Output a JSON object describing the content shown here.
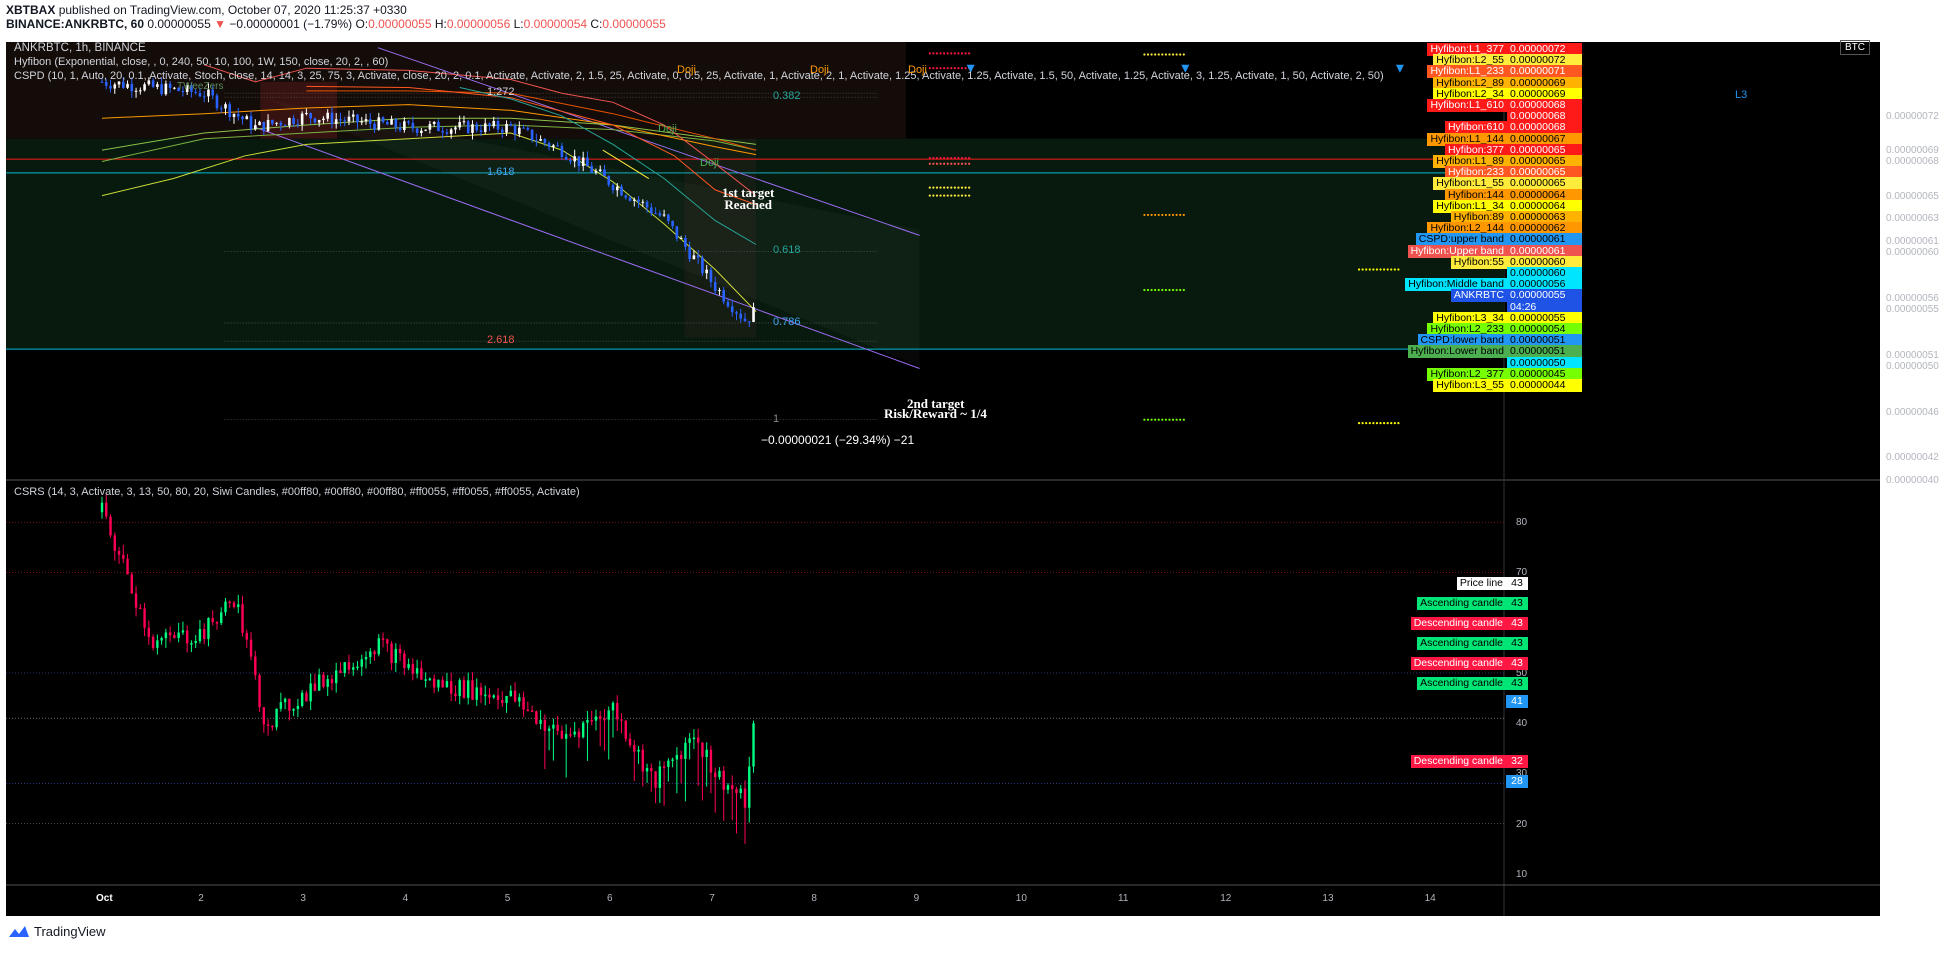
{
  "header": {
    "publisher": "XBTBAX",
    "published_on": "published on TradingView.com, October 07, 2020 11:25:37 +0330",
    "symbol": "BINANCE:ANKRBTC, 60",
    "price": "0.00000055",
    "change": "−0.00000001 (−1.79%)",
    "o_label": "O:",
    "o": "0.00000055",
    "h_label": "H:",
    "h": "0.00000056",
    "l_label": "L:",
    "l": "0.00000054",
    "c_label": "C:",
    "c": "0.00000055"
  },
  "main_pane": {
    "title": "ANKRBTC, 1h, BINANCE",
    "indicator_1": "Hyfibon (Exponential, close, , 0, 240, 50, 10, 100, 1W, 150, close, 20, 2, , 60)",
    "indicator_2": "CSPD (10, 1, Auto, 20, 0.1, Activate, Stoch, close, 14, 14, 3, 25, 75, 3, Activate, close, 20, 2, 0.1, Activate, Activate, 2, 1.5, 25, Activate, 0, 0.5, 25, Activate, 1, Activate, 2, 1, Activate, 1.25, Activate, 1.25, Activate, 1.5, 50, Activate, 1.25, Activate, 3, 1.25, Activate, 1, 50, Activate, 2, 50)",
    "currency": "BTC",
    "watermark": "TWeeZers",
    "annotations": {
      "target1": "1st target\nReached",
      "target2": "2nd target",
      "risk_reward": "Risk/Reward ~ 1/4",
      "measure": "−0.00000021 (−29.34%) −21",
      "doji": "Doji",
      "l3": "L3"
    },
    "fib_levels": [
      {
        "label": "1:272",
        "value": 7.4e-07
      },
      {
        "label": "1.618",
        "value": 6.7e-07
      },
      {
        "label": "2.618",
        "value": 5.22e-07
      },
      {
        "label": "0.382",
        "value": 7.365e-07
      },
      {
        "label": "0.618",
        "value": 6.01e-07
      },
      {
        "label": "0.786",
        "value": 5.38e-07
      },
      {
        "label": "1",
        "value": 4.53e-07
      }
    ],
    "price_axis": {
      "min": 4e-07,
      "max": 7.85e-07,
      "ticks": [
        "0.00000072",
        "0.00000069",
        "0.00000068",
        "0.00000065",
        "0.00000063",
        "0.00000061",
        "0.00000060",
        "0.00000056",
        "0.00000055",
        "0.00000051",
        "0.00000050",
        "0.00000046",
        "0.00000042",
        "0.00000040"
      ]
    },
    "price_labels": [
      {
        "name": "Hyfibon:L1_377",
        "value": "0.00000072",
        "color": "#ff1a1a"
      },
      {
        "name": "Hyfibon:L2_55",
        "value": "0.00000072",
        "color": "#ffeb3b"
      },
      {
        "name": "Hyfibon:L1_233",
        "value": "0.00000071",
        "color": "#ff5722"
      },
      {
        "name": "Hyfibon:L2_89",
        "value": "0.00000069",
        "color": "#ffb300"
      },
      {
        "name": "Hyfibon:L2_34",
        "value": "0.00000069",
        "color": "#ffff00"
      },
      {
        "name": "Hyfibon:L1_610",
        "value": "0.00000068",
        "color": "#ff1a1a"
      },
      {
        "name": "",
        "value": "0.00000068",
        "color": "#ff1a1a"
      },
      {
        "name": "Hyfibon:610",
        "value": "0.00000068",
        "color": "#ff1a1a"
      },
      {
        "name": "Hyfibon:L1_144",
        "value": "0.00000067",
        "color": "#ff9800"
      },
      {
        "name": "Hyfibon:377",
        "value": "0.00000065",
        "color": "#ff1a1a"
      },
      {
        "name": "Hyfibon:L1_89",
        "value": "0.00000065",
        "color": "#ffb300"
      },
      {
        "name": "Hyfibon:233",
        "value": "0.00000065",
        "color": "#ff5722"
      },
      {
        "name": "Hyfibon:L1_55",
        "value": "0.00000065",
        "color": "#ffeb3b"
      },
      {
        "name": "Hyfibon:144",
        "value": "0.00000064",
        "color": "#ff9800"
      },
      {
        "name": "Hyfibon:L1_34",
        "value": "0.00000064",
        "color": "#ffff00"
      },
      {
        "name": "Hyfibon:89",
        "value": "0.00000063",
        "color": "#ffb300"
      },
      {
        "name": "Hyfibon:L2_144",
        "value": "0.00000062",
        "color": "#ff9800"
      },
      {
        "name": "CSPD:upper band",
        "value": "0.00000061",
        "color": "#2196f3"
      },
      {
        "name": "Hyfibon:Upper band",
        "value": "0.00000061",
        "color": "#ef5350"
      },
      {
        "name": "Hyfibon:55",
        "value": "0.00000060",
        "color": "#ffeb3b"
      },
      {
        "name": "",
        "value": "0.00000060",
        "color": "#00e5ff"
      },
      {
        "name": "Hyfibon:Middle band",
        "value": "0.00000056",
        "color": "#00e5ff"
      },
      {
        "name": "ANKRBTC",
        "value": "0.00000055",
        "color": "#1e53e5"
      },
      {
        "name": "",
        "value": "04:26",
        "color": "#1e53e5"
      },
      {
        "name": "Hyfibon:L3_34",
        "value": "0.00000055",
        "color": "#ffff00"
      },
      {
        "name": "Hyfibon:L2_233",
        "value": "0.00000054",
        "color": "#76ff03"
      },
      {
        "name": "CSPD:lower band",
        "value": "0.00000051",
        "color": "#2196f3"
      },
      {
        "name": "Hyfibon:Lower band",
        "value": "0.00000051",
        "color": "#4caf50"
      },
      {
        "name": "",
        "value": "0.00000050",
        "color": "#00e5ff"
      },
      {
        "name": "Hyfibon:L2_377",
        "value": "0.00000045",
        "color": "#76ff03"
      },
      {
        "name": "Hyfibon:L3_55",
        "value": "0.00000044",
        "color": "#ffff00"
      }
    ]
  },
  "sub_pane": {
    "title": "CSRS (14, 3, Activate, 3, 13, 50, 80, 20, Siwi Candles, #00ff80, #00ff80, #00ff80, #ff0055, #ff0055, #ff0055, Activate)",
    "axis": {
      "min": 8,
      "max": 88,
      "ticks": [
        "80",
        "70",
        "60",
        "50",
        "40",
        "30",
        "20",
        "10"
      ]
    },
    "labels": [
      {
        "name": "Price line",
        "value": "43",
        "color": "#ffffff",
        "text": "#000"
      },
      {
        "name": "Ascending candle",
        "value": "43",
        "color": "#00e676",
        "text": "#000"
      },
      {
        "name": "Descending candle",
        "value": "43",
        "color": "#ff1744",
        "text": "#fff"
      },
      {
        "name": "Ascending candle",
        "value": "43",
        "color": "#00e676",
        "text": "#000"
      },
      {
        "name": "Descending candle",
        "value": "43",
        "color": "#ff1744",
        "text": "#fff"
      },
      {
        "name": "Ascending candle",
        "value": "43",
        "color": "#00e676",
        "text": "#000"
      },
      {
        "name": "",
        "value": "41",
        "color": "#2196f3",
        "text": "#fff"
      },
      {
        "name": "Descending candle",
        "value": "32",
        "color": "#ff1744",
        "text": "#fff"
      },
      {
        "name": "",
        "value": "28",
        "color": "#2196f3",
        "text": "#fff"
      }
    ]
  },
  "time_axis": [
    "Oct",
    "2",
    "3",
    "4",
    "5",
    "6",
    "7",
    "8",
    "9",
    "10",
    "11",
    "12",
    "13",
    "14"
  ],
  "brand": "TradingView",
  "colors": {
    "up": "#ffffff",
    "down": "#2962ff",
    "rsi_up": "#00ff80",
    "rsi_down": "#ff0055",
    "channel": "#9c6cf0",
    "hline": "#00bcd4"
  },
  "chart_data": [
    {
      "type": "candlestick",
      "title": "ANKRBTC, 1h, BINANCE",
      "x_range": [
        "Oct 1",
        "Oct 14"
      ],
      "y_range": [
        4e-07,
        7.85e-07
      ],
      "close_path": [
        {
          "t": "Oct 1",
          "v": 7.5e-07
        },
        {
          "t": "Oct 2",
          "v": 7.4e-07
        },
        {
          "t": "Oct 2.5",
          "v": 7.1e-07
        },
        {
          "t": "Oct 3",
          "v": 7.2e-07
        },
        {
          "t": "Oct 4",
          "v": 7.1e-07
        },
        {
          "t": "Oct 5",
          "v": 7.1e-07
        },
        {
          "t": "Oct 5.5",
          "v": 6.9e-07
        },
        {
          "t": "Oct 6",
          "v": 6.6e-07
        },
        {
          "t": "Oct 6.5",
          "v": 6.3e-07
        },
        {
          "t": "Oct 7",
          "v": 5.7e-07
        },
        {
          "t": "Oct 7.3",
          "v": 5.4e-07
        },
        {
          "t": "Oct 7.4",
          "v": 5.5e-07
        }
      ],
      "current_price": 5.5e-07
    },
    {
      "type": "bar",
      "title": "CSRS",
      "y_range": [
        8,
        88
      ],
      "series_end": 43,
      "levels": [
        80,
        70,
        50,
        41,
        28,
        20
      ]
    }
  ]
}
